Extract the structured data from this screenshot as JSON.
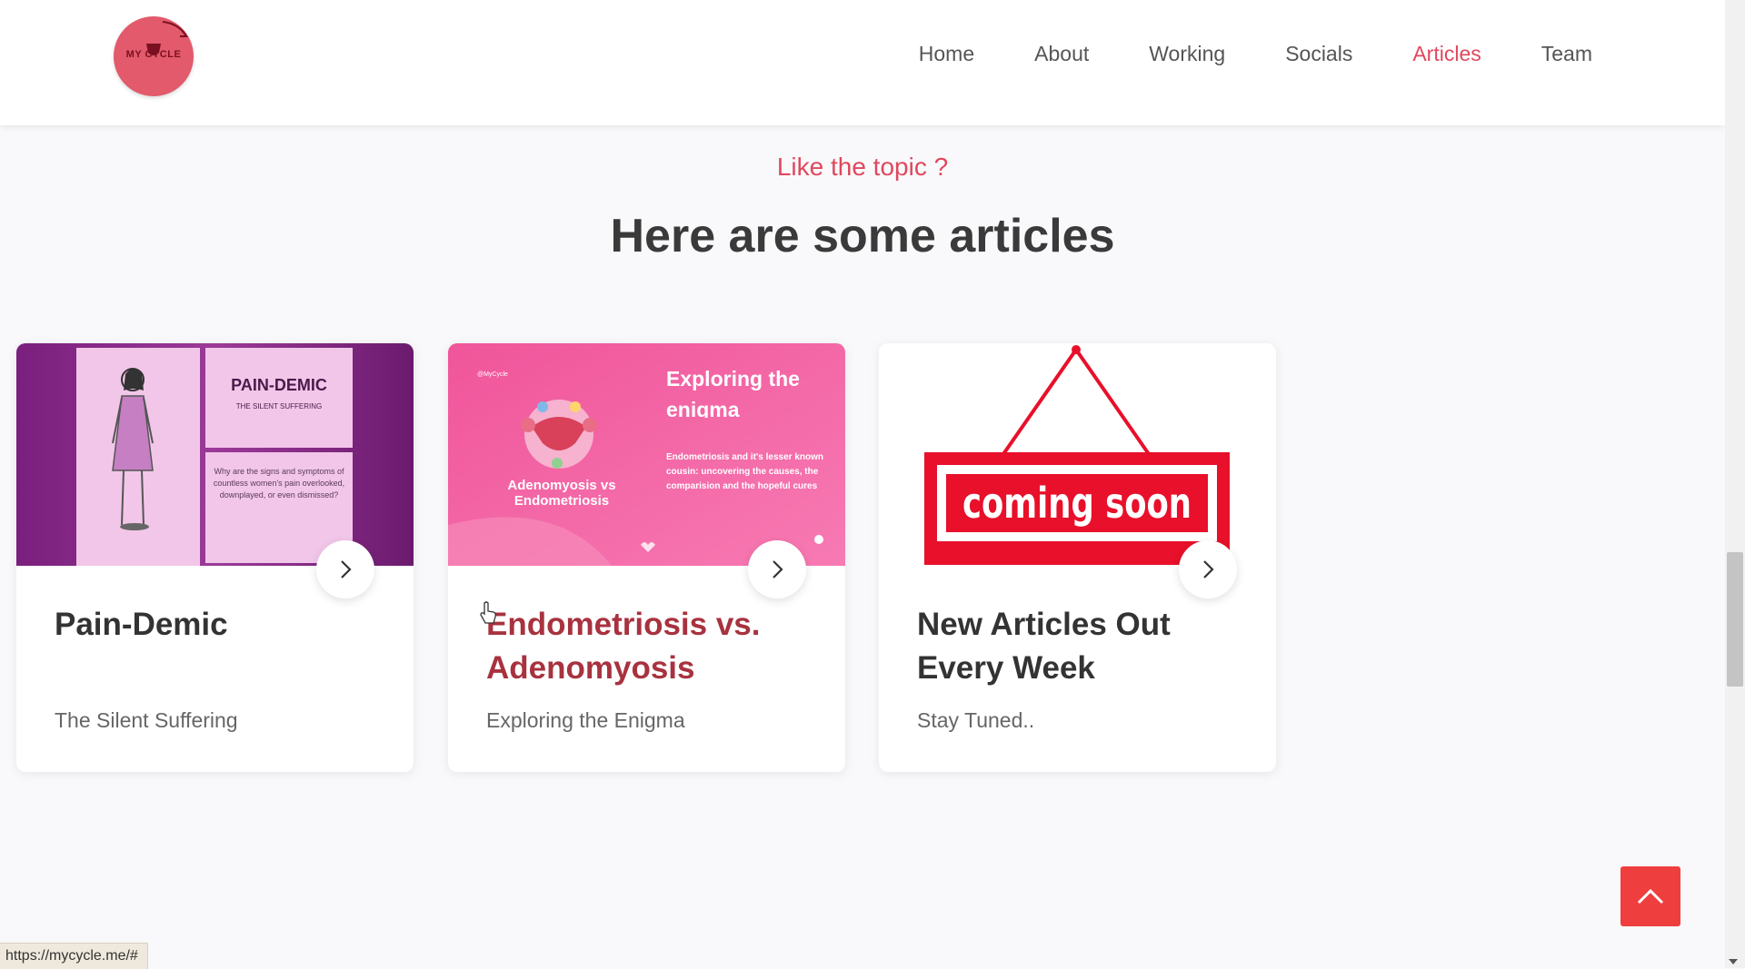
{
  "nav": {
    "items": [
      {
        "label": "Home",
        "active": false
      },
      {
        "label": "About",
        "active": false
      },
      {
        "label": "Working",
        "active": false
      },
      {
        "label": "Socials",
        "active": false
      },
      {
        "label": "Articles",
        "active": true
      },
      {
        "label": "Team",
        "active": false
      }
    ]
  },
  "logo": {
    "text": "MY CYCLE"
  },
  "section": {
    "subtitle": "Like the topic ?",
    "title": "Here are some articles"
  },
  "cards": [
    {
      "title": "Pain-Demic",
      "subtitle": "The Silent Suffering",
      "image": {
        "heading": "PAIN-DEMIC",
        "subheading": "THE SILENT SUFFERING",
        "body": "Why are the signs and symptoms of countless women's pain overlooked, downplayed, or even dismissed?"
      }
    },
    {
      "title": "Endometriosis vs. Adenomyosis",
      "subtitle": "Exploring the Enigma",
      "image": {
        "tag": "@MyCycle",
        "heading": "Exploring the enigma",
        "body": "Endometriosis and it's lesser known cousin: uncovering the causes, the comparision and the hopeful cures",
        "left_label": "Adenomyosis vs Endometriosis"
      }
    },
    {
      "title": "New Articles Out Every Week",
      "subtitle": "Stay Tuned..",
      "image": {
        "sign_text": "coming soon"
      }
    }
  ],
  "status_bar": {
    "url": "https://mycycle.me/#"
  },
  "colors": {
    "accent": "#e0485d",
    "to_top": "#ee3e3e",
    "card_hover": "#a8323f"
  }
}
